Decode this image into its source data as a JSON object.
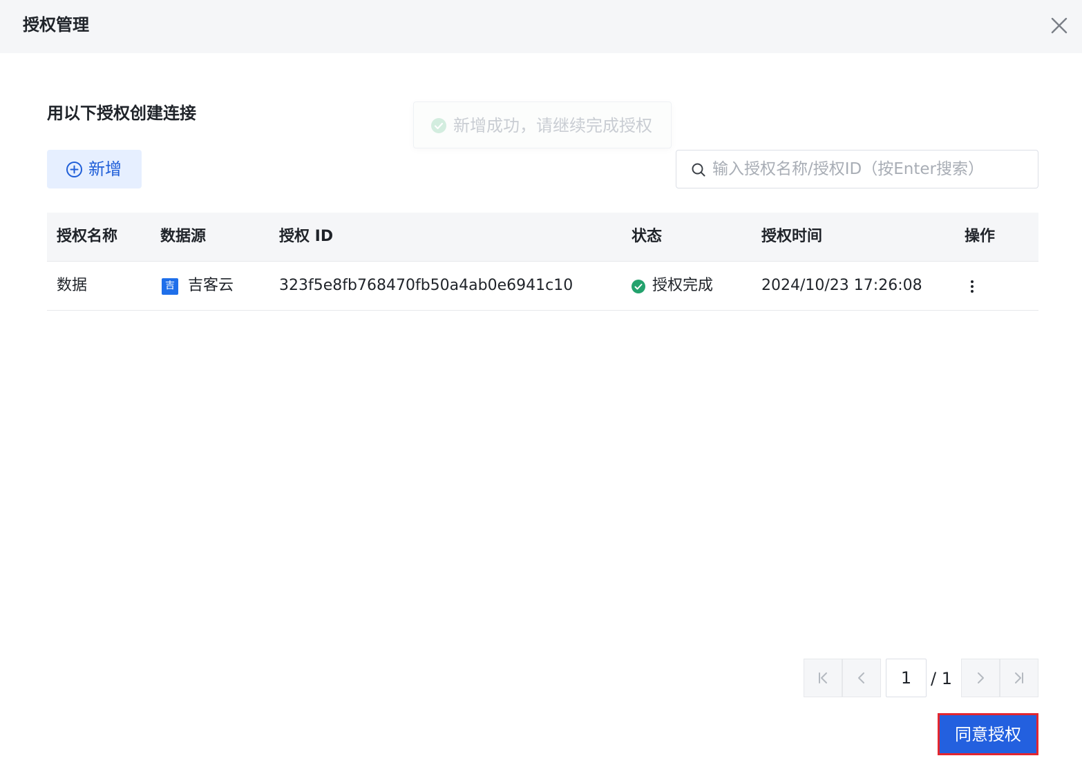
{
  "dialog": {
    "title": "授权管理"
  },
  "toast": {
    "message": "新增成功，请继续完成授权",
    "type": "success"
  },
  "section": {
    "title": "用以下授权创建连接"
  },
  "toolbar": {
    "add_label": "新增",
    "search_placeholder": "输入授权名称/授权ID（按Enter搜索）",
    "search_value": ""
  },
  "table": {
    "columns": [
      "授权名称",
      "数据源",
      "授权 ID",
      "状态",
      "授权时间",
      "操作"
    ],
    "rows": [
      {
        "name": "数据",
        "source_icon_text": "吉",
        "source": "吉客云",
        "auth_id": "323f5e8fb768470fb50a4ab0e6941c10",
        "status": "授权完成",
        "time": "2024/10/23 17:26:08"
      }
    ]
  },
  "pagination": {
    "current": "1",
    "total": "/ 1"
  },
  "footer": {
    "agree_label": "同意授权"
  },
  "colors": {
    "primary": "#2360df",
    "success": "#23a26d",
    "highlight_border": "#e3262f"
  }
}
